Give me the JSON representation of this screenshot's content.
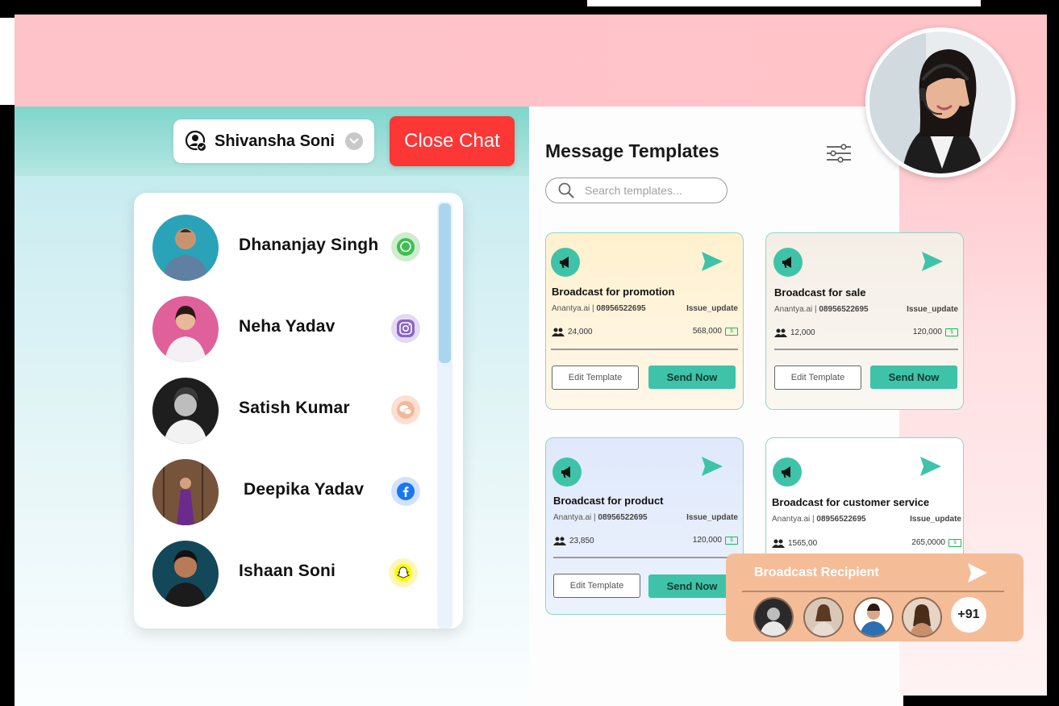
{
  "chat": {
    "selected_user": "Shivansha Soni",
    "close_label": "Close Chat",
    "contacts": [
      {
        "name": "Dhananjay Singh",
        "channel": "whatsapp-icon"
      },
      {
        "name": "Neha Yadav",
        "channel": "instagram-icon"
      },
      {
        "name": "Satish Kumar",
        "channel": "wechat-icon"
      },
      {
        "name": "Deepika Yadav",
        "channel": "facebook-icon"
      },
      {
        "name": "Ishaan Soni",
        "channel": "snapchat-icon"
      }
    ]
  },
  "templates": {
    "title": "Message Templates",
    "search_placeholder": "Search templates...",
    "cards": [
      {
        "title": "Broadcast for promotion",
        "sender": "Anantya.ai",
        "phone": "08956522695",
        "tag": "Issue_update",
        "audience": "24,000",
        "cost": "568,000",
        "edit_label": "Edit Template",
        "send_label": "Send Now"
      },
      {
        "title": "Broadcast for sale",
        "sender": "Anantya.ai",
        "phone": "08956522695",
        "tag": "Issue_update",
        "audience": "12,000",
        "cost": "120,000",
        "edit_label": "Edit Template",
        "send_label": "Send Now"
      },
      {
        "title": "Broadcast for product",
        "sender": "Anantya.ai",
        "phone": "08956522695",
        "tag": "Issue_update",
        "audience": "23,850",
        "cost": "120,000",
        "edit_label": "Edit Template",
        "send_label": "Send Now"
      },
      {
        "title": "Broadcast for customer service",
        "sender": "Anantya.ai",
        "phone": "08956522695",
        "tag": "Issue_update",
        "audience": "1565,00",
        "cost": "265,0000"
      }
    ]
  },
  "recipient": {
    "title": "Broadcast Recipient",
    "more_count": "+91"
  },
  "colors": {
    "accent": "#3ec3a9",
    "close": "#fd3636",
    "recipient_bg": "#f4bd98",
    "header_pink": "#ffc3c8"
  }
}
